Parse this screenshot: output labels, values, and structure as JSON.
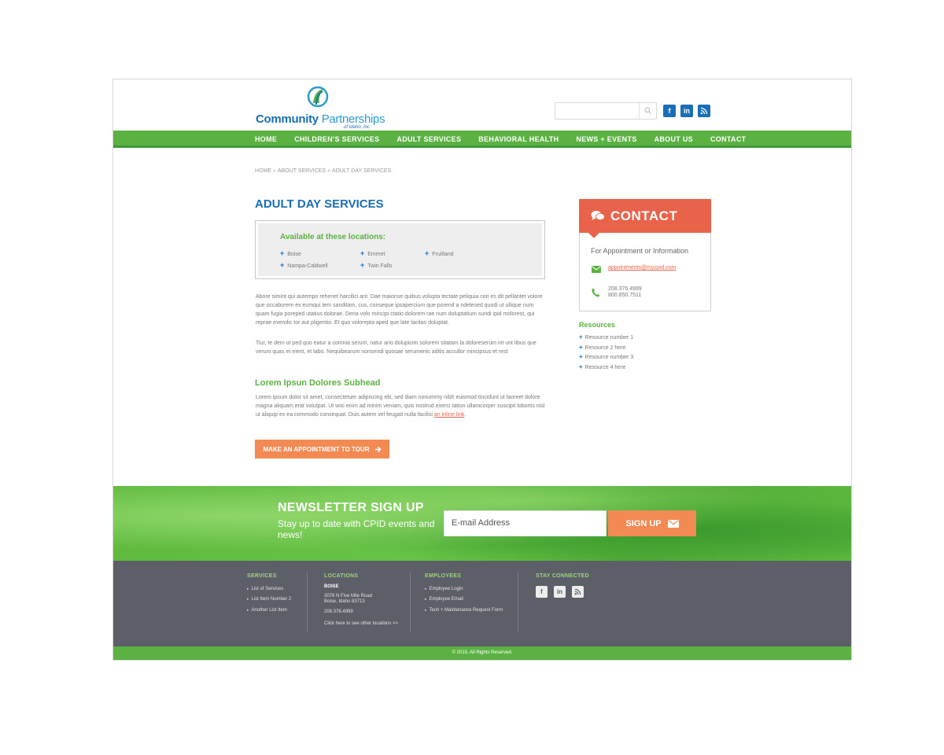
{
  "header": {
    "logo_name_1": "Community",
    "logo_name_2": "Partnerships",
    "logo_sub": "of Idaho, Inc",
    "search_placeholder": "",
    "social": [
      "facebook-icon",
      "linkedin-icon",
      "rss-icon"
    ],
    "colors": {
      "brand_blue": "#1a6eb5",
      "green": "#5cb143",
      "orange": "#e8634a"
    }
  },
  "nav": {
    "items": [
      "HOME",
      "CHILDREN'S SERVICES",
      "ADULT SERVICES",
      "BEHAVIORAL HEALTH",
      "NEWS + EVENTS",
      "ABOUT US",
      "CONTACT"
    ]
  },
  "breadcrumb": [
    "HOME",
    "ABOUT SERVICES",
    "ADULT DAY SERVICES"
  ],
  "main": {
    "title": "ADULT DAY SERVICES",
    "locations_title": "Available at these locations:",
    "locations": [
      "Boise",
      "Emmet",
      "Fruitland",
      "Nampa-Caldwell",
      "Twin Falls"
    ],
    "paragraph1": "Abore simint qui autempo rehenet harcilici ant. Dae maionse quibus volupta tectate peliquia con es dit pellantet volore que occaborem ex eumqui tem sanditam, cus, conseque ipsapercium que porend a ndelesed quodi ut ullique num quam fugia poreped utatius dolorae. Deria volo mincipi ctatio dolorem rae num doluptatium sundi ipid molorest, qui reprae evendic tor aut pligentio. Et quo volorepta aped que late lacitas doluptat.",
    "paragraph2": "Tiur, te dem ut ped quo eatur a comnia serunt, natur ario dolupicim solorem sitatam la doloreserum int unt libus que verum quas et eient, et labo. Nequibearum nonsendi quosae serumenis aditis accullor mincipsus et rest",
    "subhead": "Lorem Ipsun Dolores Subhead",
    "paragraph3": "Lorem ipsum dolor sit amet, consectetuer adipiscing elit, sed diam nonummy nibh euismod tincidunt ut laoreet dolore magna aliquam erat volutpat. Ut wisi enim ad minim veniam, quis nostrud exerci tation ullamcorper suscipit lobortis nisl ut aliquip ex ea commodo consequat. Duis autem vel feugait nulla facilisi",
    "inline_link": "an inline link",
    "paragraph3_end": ".",
    "cta_label": "MAKE AN APPOINTMENT TO TOUR"
  },
  "contact": {
    "title": "CONTACT",
    "subtitle": "For Appointment or Information",
    "email": "appointments@mycpid.com",
    "phone1": "208.376.4999",
    "phone2": "800.850.7511"
  },
  "resources": {
    "title": "Resources",
    "items": [
      "Resource number 1",
      "Resource 2 here",
      "Resource number 3",
      "Resource 4 here"
    ]
  },
  "newsletter": {
    "title": "NEWSLETTER SIGN UP",
    "subtitle": "Stay up to date with CPID events and news!",
    "input_placeholder": "E-mail Address",
    "button_label": "SIGN UP"
  },
  "footer": {
    "services_title": "SERVICES",
    "services": [
      "List of Services",
      "List Item Number 2",
      "Another List Item"
    ],
    "locations_title": "LOCATIONS",
    "location_city": "BOISE",
    "location_address1": "3076 N Five Mile Road",
    "location_address2": "Boise, Idaho 83713",
    "location_phone": "208.376.4999",
    "location_more": "Click here to see other locations >>",
    "employees_title": "EMPLOYEES",
    "employees": [
      "Employee Login",
      "Employee Email",
      "Tech + Maintenance Request Form"
    ],
    "connected_title": "STAY CONNECTED",
    "copyright": "© 2015, All Rights Reserved."
  }
}
